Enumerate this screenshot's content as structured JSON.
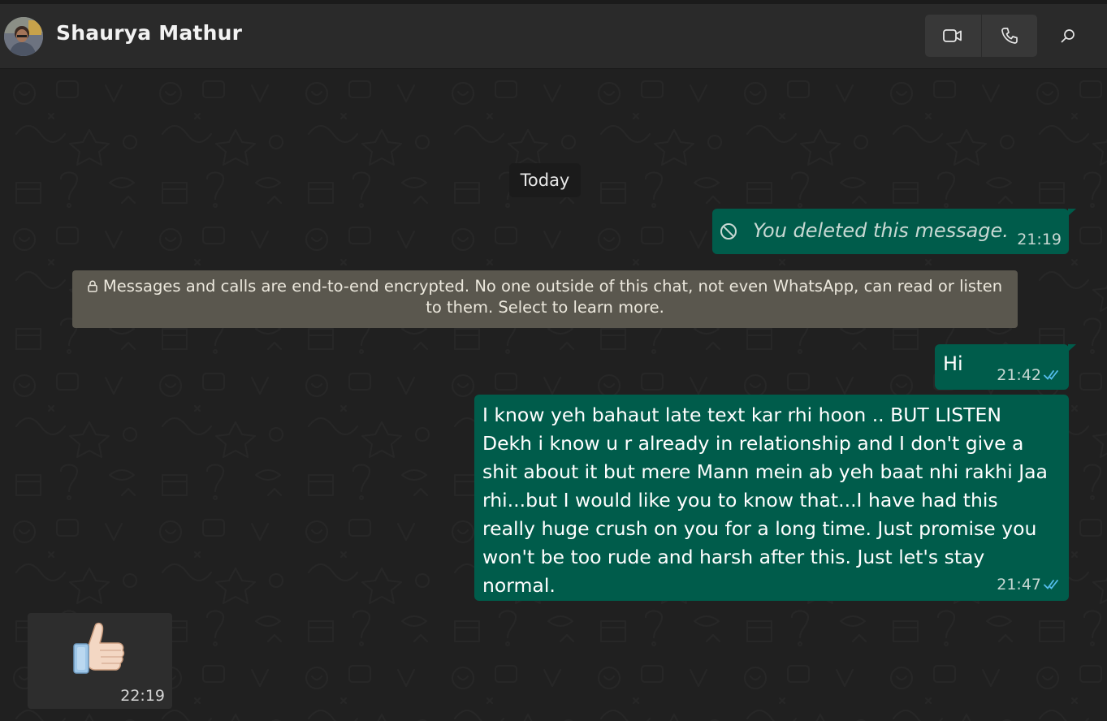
{
  "header": {
    "contact_name": "Shaurya Mathur",
    "icons": [
      "video-camera-icon",
      "phone-icon",
      "search-icon"
    ]
  },
  "chat": {
    "date_separator": "Today",
    "messages": [
      {
        "direction": "outgoing",
        "deleted": true,
        "text": "You deleted this message.",
        "time": "21:19",
        "icon": "ban-icon"
      },
      {
        "direction": "outgoing",
        "text": "Hi",
        "time": "21:42",
        "status_icon": "double-check-icon"
      },
      {
        "direction": "outgoing",
        "text": "I know yeh bahaut late text kar rhi hoon .. BUT LISTEN\nDekh i know u r already in relationship and I don't give a shit about it but mere Mann mein ab yeh baat nhi rakhi Jaa rhi...but I would like you to know that...I have had this really huge crush on you for a long time. Just promise you won't be too rude and harsh after this. Just let's stay normal.",
        "time": "21:47",
        "status_icon": "double-check-icon"
      },
      {
        "direction": "incoming",
        "emoji": "thumbs-up",
        "time": "22:19"
      }
    ],
    "encryption_notice": "Messages and calls are end-to-end encrypted. No one outside of this chat, not even WhatsApp, can read or listen to them. Select to learn more."
  },
  "colors": {
    "header_bg": "#2a2a2a",
    "chat_bg": "#202020",
    "outgoing_bubble": "#005c4b",
    "incoming_bubble": "#2d2d2d",
    "system_notice": "#5a574e",
    "read_tick": "#53bdeb"
  }
}
